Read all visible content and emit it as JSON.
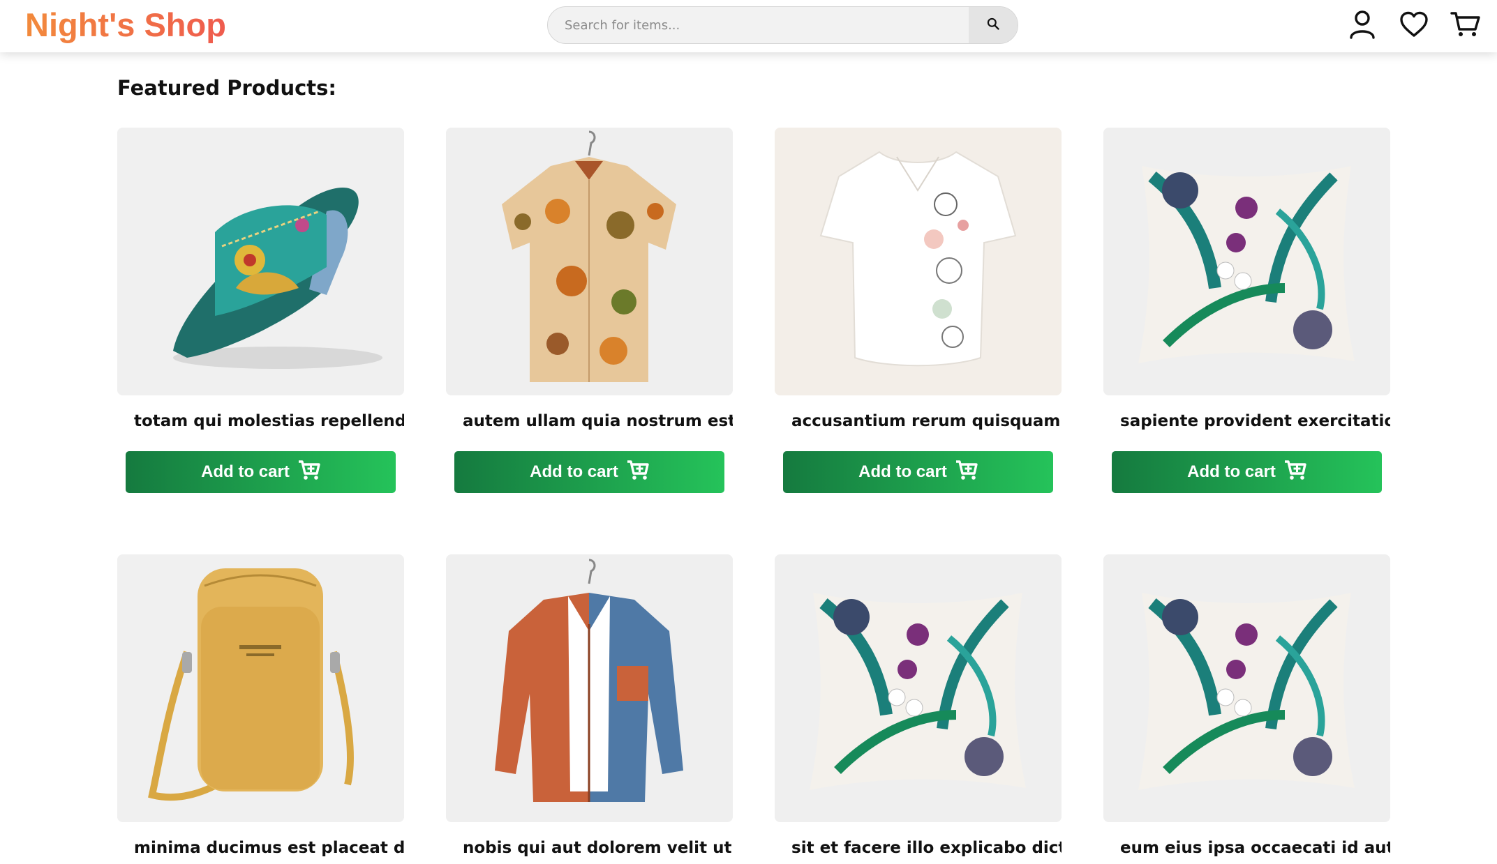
{
  "header": {
    "logo": "Night's Shop",
    "search_placeholder": "Search for items...",
    "icons": [
      "search-icon",
      "user-icon",
      "heart-icon",
      "cart-icon"
    ]
  },
  "section_title": "Featured Products:",
  "add_to_cart_label": "Add to cart",
  "products": [
    {
      "title": "totam qui molestias repellend...",
      "image": "sandal"
    },
    {
      "title": "autem ullam quia nostrum est ...",
      "image": "floral-shirt"
    },
    {
      "title": "accusantium rerum quisquam ...",
      "image": "white-blouse"
    },
    {
      "title": "sapiente provident exercitatio...",
      "image": "tropical-pillow"
    },
    {
      "title": "minima ducimus est placeat d...",
      "image": "yellow-bag"
    },
    {
      "title": "nobis qui aut dolorem velit ut",
      "image": "orange-blue-jacket"
    },
    {
      "title": "sit et facere illo explicabo dicta",
      "image": "tropical-pillow"
    },
    {
      "title": "eum eius ipsa occaecati id aut",
      "image": "tropical-pillow"
    }
  ],
  "colors": {
    "logo_gradient": [
      "#f28a3c",
      "#ef5b4e"
    ],
    "button_gradient": [
      "#157a3f",
      "#25c35a"
    ]
  }
}
